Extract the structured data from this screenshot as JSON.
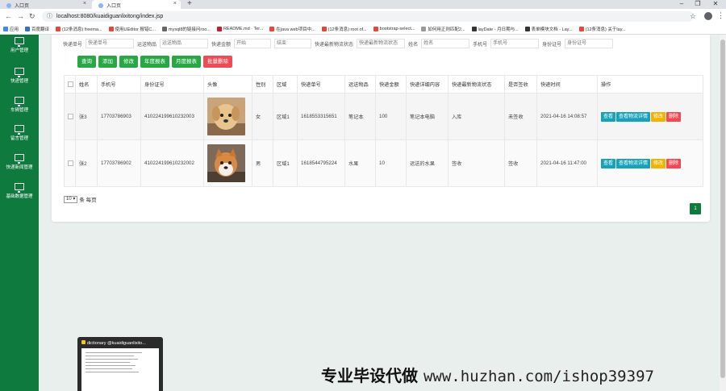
{
  "browser": {
    "tabs": [
      {
        "label": "入口页"
      },
      {
        "label": "入口页"
      }
    ],
    "url": "localhost:8080/kuaidiguanlixitong/index.jsp",
    "bookmarks": [
      {
        "label": "应用",
        "color": "#4285f4"
      },
      {
        "label": "百度翻译",
        "color": "#2f6fd6"
      },
      {
        "label": "(12条消息) freema...",
        "color": "#e8453c"
      },
      {
        "label": "使用UEditor 报错C...",
        "color": "#e8453c"
      },
      {
        "label": "mysql8的链接问roo...",
        "color": "#666666"
      },
      {
        "label": "README.md · Ter...",
        "color": "#c71d23"
      },
      {
        "label": "在java web项目中...",
        "color": "#e8453c"
      },
      {
        "label": "(12条消息) root of...",
        "color": "#e8453c"
      },
      {
        "label": "bootstrap-select...",
        "color": "#e8453c"
      },
      {
        "label": "如何用正则匹配2...",
        "color": "#999999"
      },
      {
        "label": "layDate - 月日期与...",
        "color": "#333333"
      },
      {
        "label": "表单模块文档 - Lay...",
        "color": "#333333"
      },
      {
        "label": "(12条消息) 关于lay...",
        "color": "#e8453c"
      }
    ]
  },
  "sidebar": {
    "items": [
      {
        "label": "用户管理"
      },
      {
        "label": "快递管理"
      },
      {
        "label": "车辆管理"
      },
      {
        "label": "留言管理"
      },
      {
        "label": "快递新闻管理"
      },
      {
        "label": "基础数据管理"
      }
    ]
  },
  "search": {
    "fields": [
      {
        "label": "快递单号",
        "placeholder": "快递单号"
      },
      {
        "label": "运送物品",
        "placeholder": "运送物品"
      },
      {
        "label": "快递金额",
        "placeholder": "开始"
      },
      {
        "label": "",
        "placeholder": "结束"
      },
      {
        "label": "快递最新物流状态",
        "placeholder": "快递最新物流状态"
      },
      {
        "label": "姓名",
        "placeholder": "姓名"
      },
      {
        "label": "手机号",
        "placeholder": "手机号"
      },
      {
        "label": "身份证号",
        "placeholder": "身份证号"
      }
    ]
  },
  "toolbar": {
    "query": "查询",
    "add": "添加",
    "edit": "修改",
    "year_report": "年度报表",
    "month_report": "月度报表",
    "batch_delete": "批量删除"
  },
  "table": {
    "headers": [
      "",
      "姓名",
      "手机号",
      "身份证号",
      "头像",
      "性别",
      "区域",
      "快递单号",
      "运送物品",
      "快递金额",
      "快递详细内容",
      "快递最新物流状态",
      "是否签收",
      "快递时间",
      "操作"
    ],
    "rows": [
      {
        "name": "张3",
        "phone": "17703786903",
        "id_card": "410224199610232003",
        "avatar": "puppy-golden",
        "gender": "女",
        "region": "区域1",
        "tracking": "1618553315651",
        "goods": "笔记本",
        "amount": "100",
        "detail": "笔记本电脑",
        "status": "入库",
        "signed": "未签收",
        "time": "2021-04-16 14:08:57"
      },
      {
        "name": "张2",
        "phone": "17703786902",
        "id_card": "410224199610232002",
        "avatar": "puppy-shiba",
        "gender": "男",
        "region": "区域1",
        "tracking": "1618544795224",
        "goods": "水果",
        "amount": "10",
        "detail": "运送的水果",
        "status": "签收",
        "signed": "签收",
        "time": "2021-04-16 11:47:00"
      }
    ],
    "actions": {
      "view": "查看",
      "logistics": "查看物流详情",
      "edit": "修改",
      "delete": "删除"
    }
  },
  "pagination": {
    "page_size": "10",
    "suffix": "条 每页",
    "current_page": "1"
  },
  "taskbar_preview": {
    "title": "dictionary @kuaidiguanlixito..."
  },
  "watermark": {
    "text": "专业毕设代做",
    "url": "www.huzhan.com/ishop39397"
  }
}
